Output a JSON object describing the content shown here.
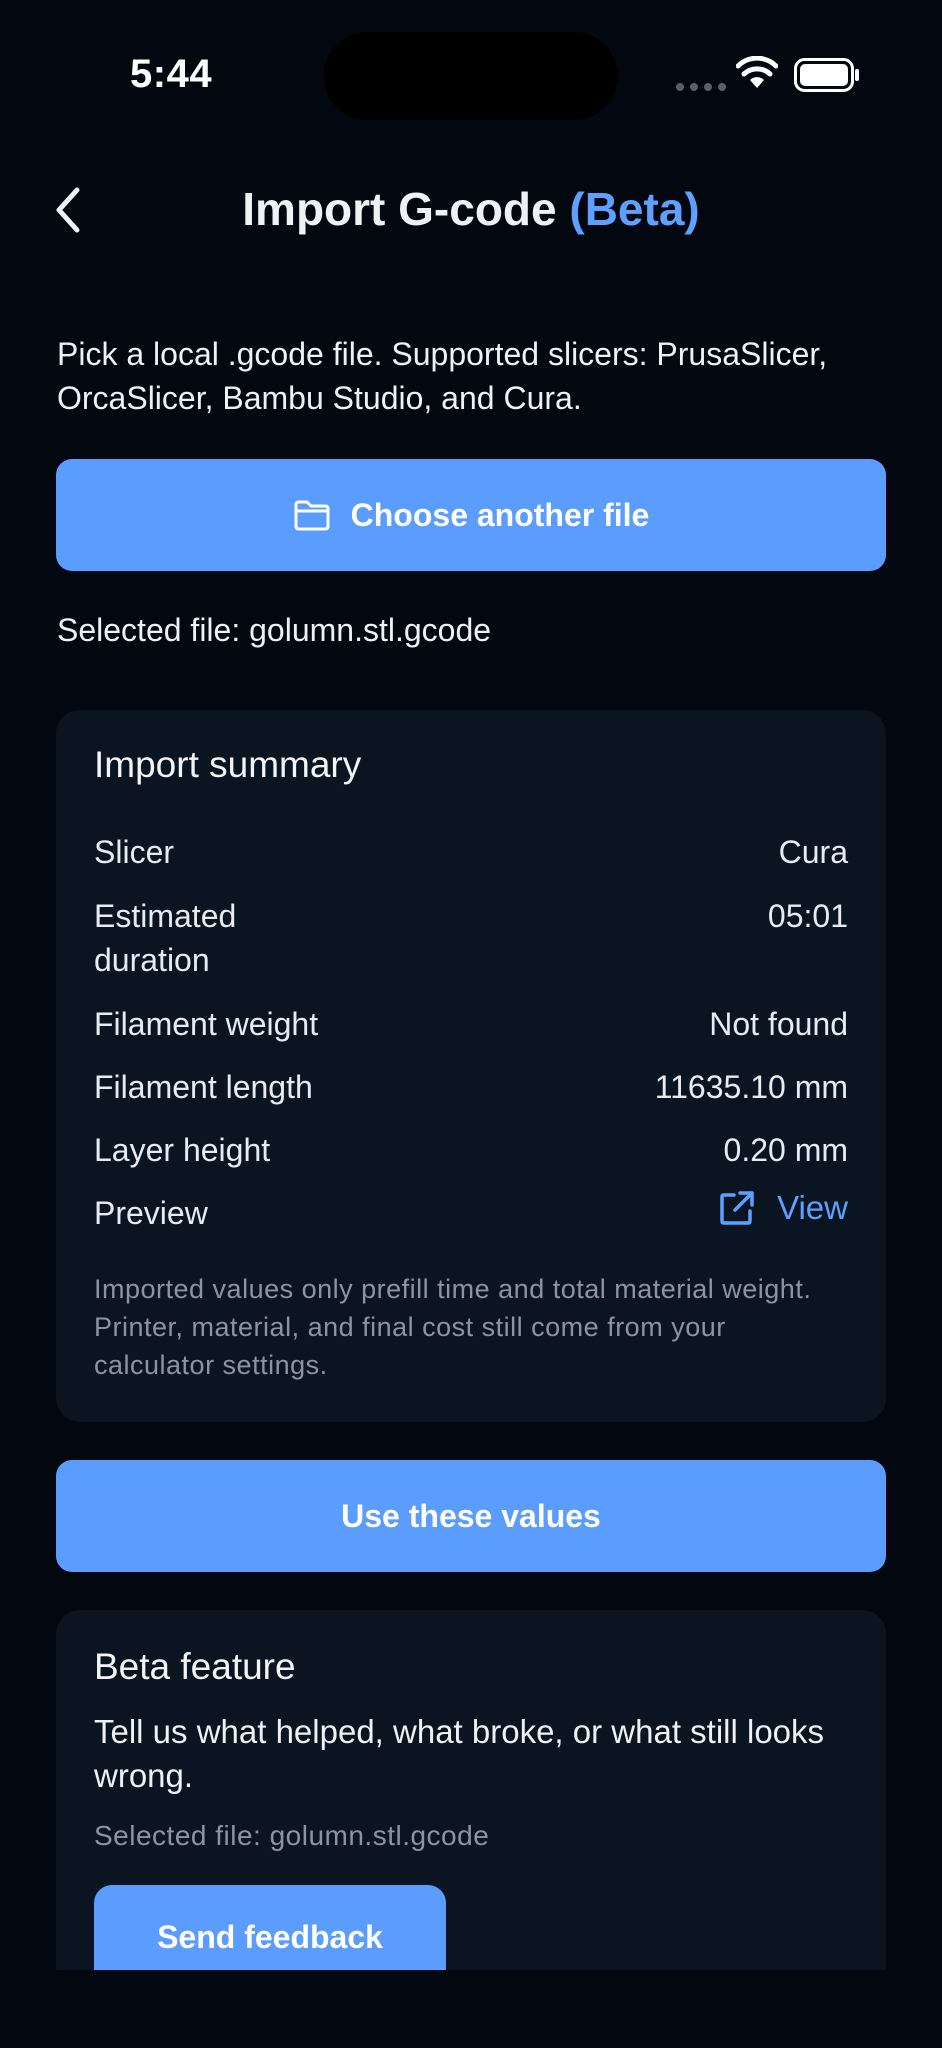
{
  "status_bar": {
    "time": "5:44"
  },
  "header": {
    "title": "Import G-code",
    "title_badge": "(Beta)"
  },
  "intro": "Pick a local .gcode file. Supported slicers: PrusaSlicer, OrcaSlicer, Bambu Studio, and Cura.",
  "choose_button_label": "Choose another file",
  "selected_file": "Selected file: golumn.stl.gcode",
  "summary": {
    "title": "Import summary",
    "rows": [
      {
        "label": "Slicer",
        "value": "Cura"
      },
      {
        "label": "Estimated duration",
        "value": "05:01"
      },
      {
        "label": "Filament weight",
        "value": "Not found"
      },
      {
        "label": "Filament length",
        "value": "11635.10 mm"
      },
      {
        "label": "Layer height",
        "value": "0.20 mm"
      },
      {
        "label": "Preview",
        "value": ""
      }
    ],
    "preview_link": "View",
    "note": "Imported values only prefill time and total material weight. Printer, material, and final cost still come from your calculator settings."
  },
  "use_button_label": "Use these values",
  "beta": {
    "title": "Beta feature",
    "description": "Tell us what helped, what broke, or what still looks wrong.",
    "selected_file": "Selected file: golumn.stl.gcode",
    "feedback_label": "Send feedback"
  },
  "colors": {
    "background": "#03070f",
    "card": "#0b1522",
    "accent": "#5a9dff",
    "accent_text": "#5ea0ff",
    "muted_text": "#8a94a3"
  }
}
